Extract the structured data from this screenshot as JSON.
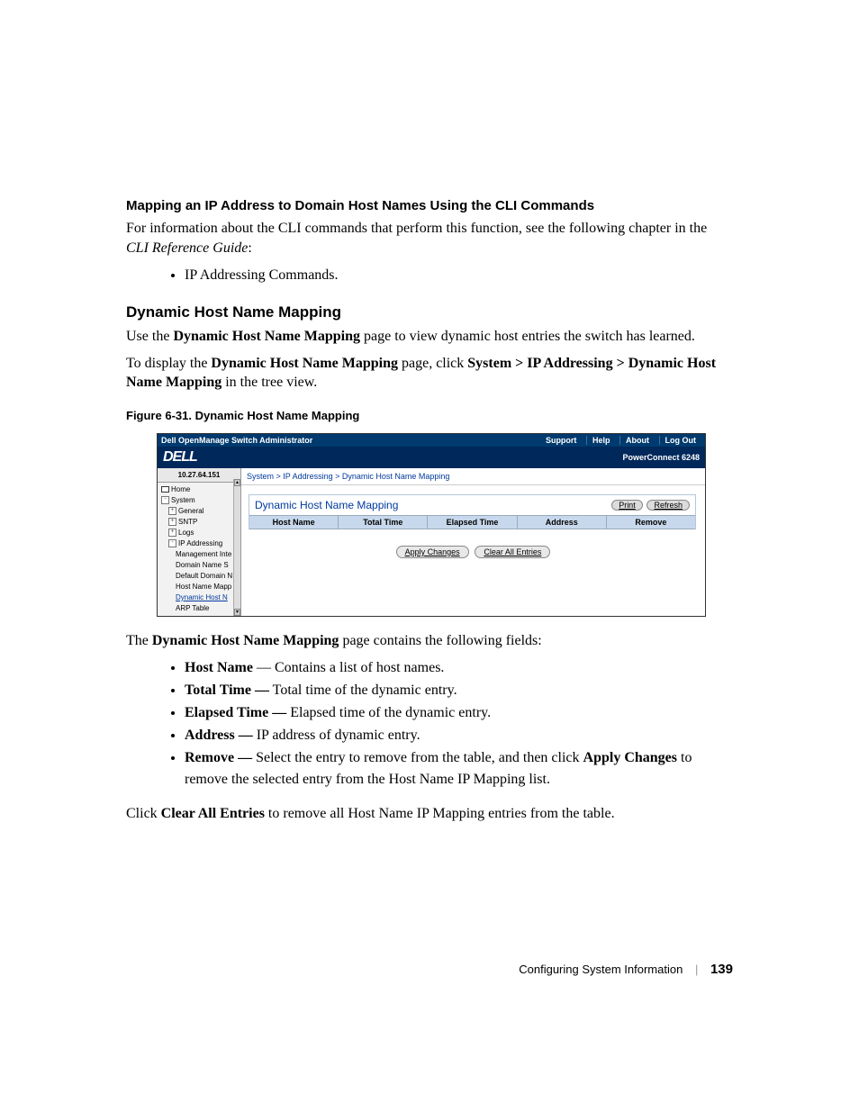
{
  "section1": {
    "heading": "Mapping an IP Address to Domain Host Names Using the CLI Commands",
    "intro_pre": "For information about the CLI commands that perform this function, see the following chapter in the ",
    "intro_ref": "CLI Reference Guide",
    "intro_post": ":",
    "bullets": [
      "IP Addressing Commands."
    ]
  },
  "section2": {
    "heading": "Dynamic Host Name Mapping",
    "p1_pre": "Use the ",
    "p1_bold": "Dynamic Host Name Mapping",
    "p1_post": " page to view dynamic host entries the switch has learned.",
    "p2_pre": "To display the ",
    "p2_bold1": "Dynamic Host Name Mapping",
    "p2_mid": " page, click ",
    "p2_bold2": "System > IP Addressing > Dynamic Host Name Mapping",
    "p2_post": " in the tree view."
  },
  "figure": {
    "caption": "Figure 6-31.    Dynamic Host Name Mapping"
  },
  "shot": {
    "topbar_title": "Dell OpenManage Switch Administrator",
    "topbar_links": [
      "Support",
      "Help",
      "About",
      "Log Out"
    ],
    "logo": "DELL",
    "model": "PowerConnect 6248",
    "nav_ip": "10.27.64.151",
    "nav": {
      "home": "Home",
      "system": "System",
      "general": "General",
      "sntp": "SNTP",
      "logs": "Logs",
      "ip_addressing": "IP Addressing",
      "mgmt": "Management Inte",
      "dns": "Domain Name S",
      "defdom": "Default Domain N",
      "hostmap": "Host Name Mapp",
      "dynhost": "Dynamic Host N",
      "arp": "ARP Table"
    },
    "breadcrumb": "System > IP Addressing > Dynamic Host Name Mapping",
    "panel_title": "Dynamic Host Name Mapping",
    "btn_print": "Print",
    "btn_refresh": "Refresh",
    "cols": [
      "Host Name",
      "Total Time",
      "Elapsed Time",
      "Address",
      "Remove"
    ],
    "btn_apply": "Apply Changes",
    "btn_clear": "Clear All Entries"
  },
  "fields_intro_pre": "The ",
  "fields_intro_bold": "Dynamic Host Name Mapping",
  "fields_intro_post": " page contains the following fields:",
  "fields": [
    {
      "term": "Host Name",
      "sep": " — ",
      "desc": "Contains a list of host names."
    },
    {
      "term": "Total Time —",
      "sep": " ",
      "desc": "Total time of the dynamic entry."
    },
    {
      "term": "Elapsed Time —",
      "sep": " ",
      "desc": "Elapsed time of the dynamic entry."
    },
    {
      "term": "Address —",
      "sep": " ",
      "desc": "IP address of dynamic entry."
    }
  ],
  "field_remove": {
    "term": "Remove —",
    "pre": " Select the entry to remove from the table, and then click ",
    "bold": "Apply Changes",
    "post": " to remove the selected entry from the Host Name IP Mapping list."
  },
  "closing": {
    "pre": "Click ",
    "bold": "Clear All Entries",
    "post": " to remove all Host Name IP Mapping entries from the table."
  },
  "footer": {
    "title": "Configuring System Information",
    "page": "139"
  }
}
